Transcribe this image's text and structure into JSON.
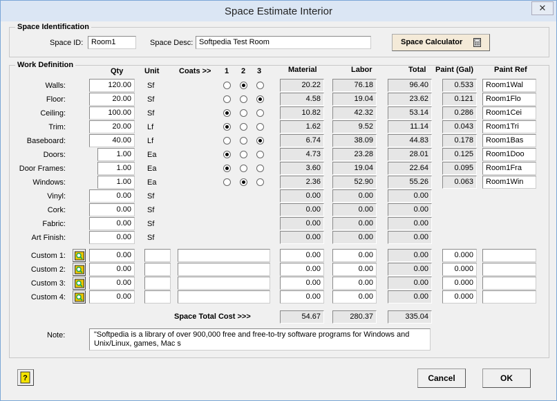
{
  "window": {
    "title": "Space Estimate Interior",
    "close_glyph": "✕"
  },
  "space_id": {
    "group_label": "Space Identification",
    "id_label": "Space ID:",
    "id_value": "Room1",
    "desc_label": "Space Desc:",
    "desc_value": "Softpedia Test Room",
    "calculator_button": "Space Calculator"
  },
  "work": {
    "group_label": "Work Definition",
    "headers": {
      "qty": "Qty",
      "unit": "Unit",
      "coats": "Coats >>",
      "c1": "1",
      "c2": "2",
      "c3": "3",
      "material": "Material",
      "labor": "Labor",
      "total": "Total",
      "paint": "Paint (Gal)",
      "paint_ref": "Paint Ref"
    },
    "rows": [
      {
        "label": "Walls:",
        "qty": "120.00",
        "unit": "Sf",
        "coats": 2,
        "material": "20.22",
        "labor": "76.18",
        "total": "96.40",
        "paint": "0.533",
        "ref": "Room1Wal"
      },
      {
        "label": "Floor:",
        "qty": "20.00",
        "unit": "Sf",
        "coats": 3,
        "material": "4.58",
        "labor": "19.04",
        "total": "23.62",
        "paint": "0.121",
        "ref": "Room1Flo"
      },
      {
        "label": "Ceiling:",
        "qty": "100.00",
        "unit": "Sf",
        "coats": 1,
        "material": "10.82",
        "labor": "42.32",
        "total": "53.14",
        "paint": "0.286",
        "ref": "Room1Cei"
      },
      {
        "label": "Trim:",
        "qty": "20.00",
        "unit": "Lf",
        "coats": 1,
        "material": "1.62",
        "labor": "9.52",
        "total": "11.14",
        "paint": "0.043",
        "ref": "Room1Tri"
      },
      {
        "label": "Baseboard:",
        "qty": "40.00",
        "unit": "Lf",
        "coats": 3,
        "material": "6.74",
        "labor": "38.09",
        "total": "44.83",
        "paint": "0.178",
        "ref": "Room1Bas"
      },
      {
        "label": "Doors:",
        "qty": "1.00",
        "unit": "Ea",
        "coats": 1,
        "material": "4.73",
        "labor": "23.28",
        "total": "28.01",
        "paint": "0.125",
        "ref": "Room1Doo"
      },
      {
        "label": "Door Frames:",
        "qty": "1.00",
        "unit": "Ea",
        "coats": 1,
        "material": "3.60",
        "labor": "19.04",
        "total": "22.64",
        "paint": "0.095",
        "ref": "Room1Fra"
      },
      {
        "label": "Windows:",
        "qty": "1.00",
        "unit": "Ea",
        "coats": 2,
        "material": "2.36",
        "labor": "52.90",
        "total": "55.26",
        "paint": "0.063",
        "ref": "Room1Win"
      },
      {
        "label": "Vinyl:",
        "qty": "0.00",
        "unit": "Sf",
        "material": "0.00",
        "labor": "0.00",
        "total": "0.00"
      },
      {
        "label": "Cork:",
        "qty": "0.00",
        "unit": "Sf",
        "material": "0.00",
        "labor": "0.00",
        "total": "0.00"
      },
      {
        "label": "Fabric:",
        "qty": "0.00",
        "unit": "Sf",
        "material": "0.00",
        "labor": "0.00",
        "total": "0.00"
      },
      {
        "label": "Art Finish:",
        "qty": "0.00",
        "unit": "Sf",
        "material": "0.00",
        "labor": "0.00",
        "total": "0.00"
      }
    ],
    "custom": [
      {
        "label": "Custom 1:",
        "qty": "0.00",
        "unit": "",
        "desc": "",
        "material": "0.00",
        "labor": "0.00",
        "total": "0.00",
        "paint": "0.000",
        "ref": ""
      },
      {
        "label": "Custom 2:",
        "qty": "0.00",
        "unit": "",
        "desc": "",
        "material": "0.00",
        "labor": "0.00",
        "total": "0.00",
        "paint": "0.000",
        "ref": ""
      },
      {
        "label": "Custom 3:",
        "qty": "0.00",
        "unit": "",
        "desc": "",
        "material": "0.00",
        "labor": "0.00",
        "total": "0.00",
        "paint": "0.000",
        "ref": ""
      },
      {
        "label": "Custom 4:",
        "qty": "0.00",
        "unit": "",
        "desc": "",
        "material": "0.00",
        "labor": "0.00",
        "total": "0.00",
        "paint": "0.000",
        "ref": ""
      }
    ],
    "total_label": "Space Total Cost >>>",
    "total_material": "54.67",
    "total_labor": "280.37",
    "total_total": "335.04",
    "note_label": "Note:",
    "note_value": "\"Softpedia is a library of over 900,000 free and free-to-try software programs for Windows and Unix/Linux, games, Mac s"
  },
  "buttons": {
    "cancel": "Cancel",
    "ok": "OK",
    "help_icon": "help-book-icon"
  }
}
